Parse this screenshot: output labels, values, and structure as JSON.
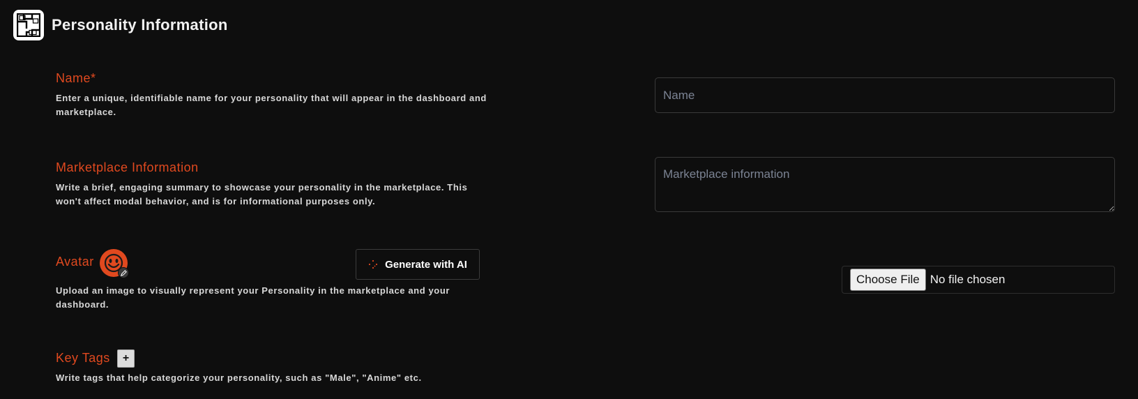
{
  "header": {
    "title": "Personality Information"
  },
  "fields": {
    "name": {
      "label": "Name*",
      "description": "Enter a unique, identifiable name for your personality that will appear in the dashboard and marketplace.",
      "placeholder": "Name"
    },
    "marketplace": {
      "label": "Marketplace Information",
      "description": "Write a brief, engaging summary to showcase your personality in the marketplace. This won't affect modal behavior, and is for informational purposes only.",
      "placeholder": "Marketplace information"
    },
    "avatar": {
      "label": "Avatar",
      "description": "Upload an image to visually represent your Personality in the marketplace and your dashboard.",
      "generate_label": "Generate with AI",
      "choose_file_label": "Choose File",
      "file_status": "No file chosen"
    },
    "tags": {
      "label": "Key Tags",
      "add_label": "+",
      "description": "Write tags that help categorize your personality, such as \"Male\", \"Anime\" etc."
    }
  },
  "colors": {
    "accent": "#e0491f",
    "background": "#0e0e0e",
    "border": "#3a3a3a"
  },
  "icons": [
    "app-logo-icon",
    "avatar-smiley-icon",
    "edit-pencil-icon",
    "sparkle-icon"
  ]
}
